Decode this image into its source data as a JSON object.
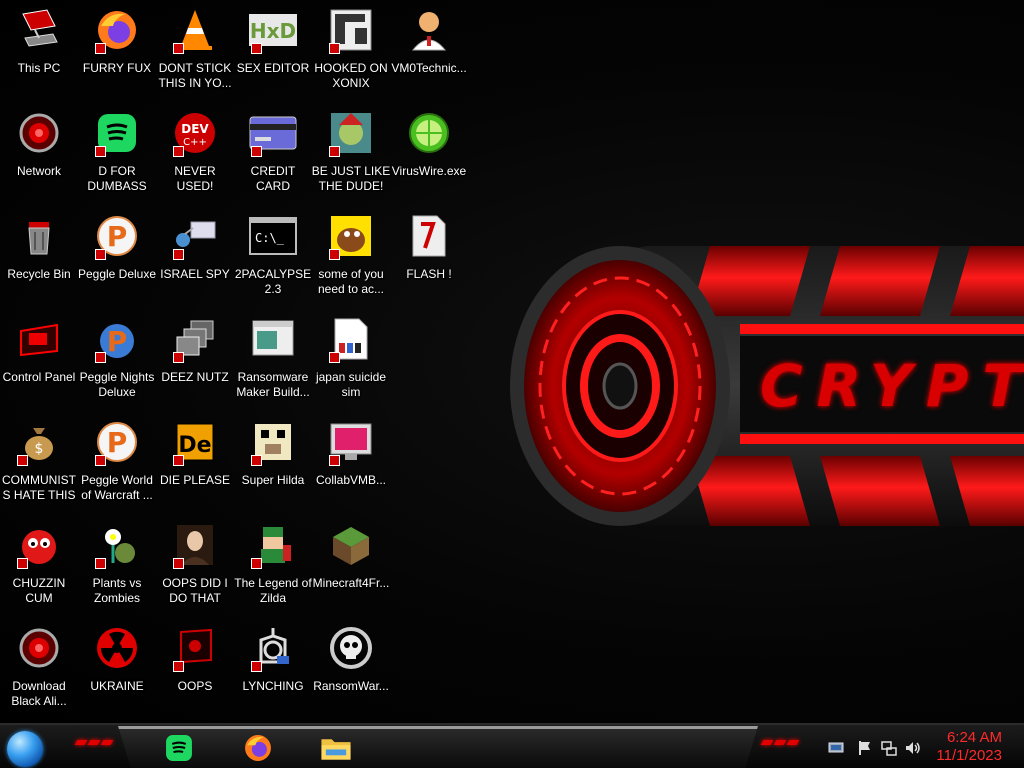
{
  "wallpaper": {
    "text": "CRYPTIC"
  },
  "icons": [
    {
      "label": "This PC"
    },
    {
      "label": "FURRY FUX"
    },
    {
      "label": "DONT STICK THIS IN YO..."
    },
    {
      "label": "SEX EDITOR"
    },
    {
      "label": "HOOKED ON XONIX"
    },
    {
      "label": "VM0Technic..."
    },
    {
      "label": "Network"
    },
    {
      "label": "D FOR DUMBASS"
    },
    {
      "label": "NEVER USED!"
    },
    {
      "label": "CREDIT CARD CHECKER"
    },
    {
      "label": "BE JUST LIKE THE DUDE!"
    },
    {
      "label": "VirusWire.exe"
    },
    {
      "label": "Recycle Bin"
    },
    {
      "label": "Peggle Deluxe"
    },
    {
      "label": "ISRAEL SPY"
    },
    {
      "label": "2PACALYPSE 2.3"
    },
    {
      "label": "some of you need to ac..."
    },
    {
      "label": "FLASH !"
    },
    {
      "label": "Control Panel"
    },
    {
      "label": "Peggle Nights Deluxe"
    },
    {
      "label": "DEEZ NUTZ"
    },
    {
      "label": "Ransomware Maker Build..."
    },
    {
      "label": "japan suicide sim"
    },
    {
      "label": "COMMUNISTS HATE THIS G..."
    },
    {
      "label": "Peggle World of Warcraft ..."
    },
    {
      "label": "DIE PLEASE"
    },
    {
      "label": "Super Hilda"
    },
    {
      "label": "CollabVMB..."
    },
    {
      "label": "CHUZZIN CUM"
    },
    {
      "label": "Plants vs Zombies"
    },
    {
      "label": "OOPS DID I DO THAT"
    },
    {
      "label": "The Legend of Zilda"
    },
    {
      "label": "Minecraft4Fr..."
    },
    {
      "label": "Download Black Ali..."
    },
    {
      "label": "UKRAINE"
    },
    {
      "label": "OOPS"
    },
    {
      "label": "LYNCHING"
    },
    {
      "label": "RansomWar..."
    }
  ],
  "taskbar": {
    "pinned": [
      "spotify-icon",
      "firefox-icon",
      "file-explorer-icon"
    ],
    "tray": [
      "network-adapter-icon",
      "action-center-flag-icon",
      "ethernet-icon",
      "volume-icon"
    ],
    "clock": {
      "time": "6:24 AM",
      "date": "11/1/2023"
    }
  },
  "colors": {
    "accent_red": "#e00000",
    "clock_red": "#ff2a2a",
    "start_blue": "#3aa0f0"
  }
}
